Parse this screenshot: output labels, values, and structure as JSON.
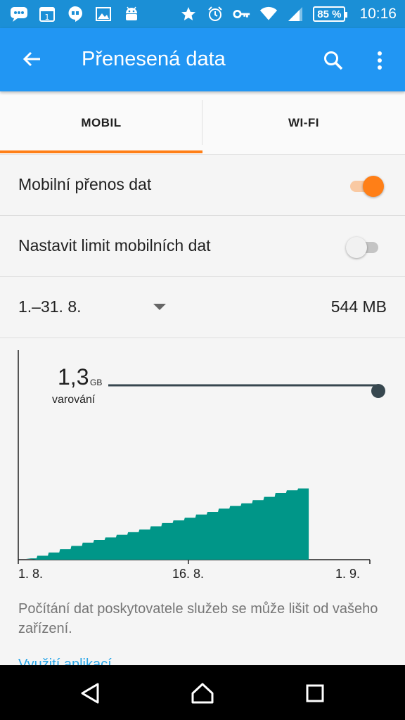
{
  "statusbar": {
    "battery": "85 %",
    "time": "10:16",
    "left_icons": [
      "chat-icon",
      "calendar-icon",
      "hangouts-icon",
      "gallery-icon",
      "android-icon"
    ],
    "right_icons": [
      "star-icon",
      "alarm-icon",
      "key-icon",
      "wifi-icon",
      "signal-icon"
    ],
    "calendar_day": "1"
  },
  "appbar": {
    "title": "Přenesená data"
  },
  "tabs": {
    "mobil": "MOBIL",
    "wifi": "WI-FI",
    "active": "mobil"
  },
  "settings": {
    "mobile_data_label": "Mobilní přenos dat",
    "mobile_data_on": true,
    "limit_label": "Nastavit limit mobilních dat",
    "limit_on": false
  },
  "period": {
    "range": "1.–31. 8.",
    "total": "544 MB"
  },
  "chart_data": {
    "type": "area",
    "warning_value": "1,3",
    "warning_unit": "GB",
    "warning_label": "varování",
    "x_tick_labels": [
      "1. 8.",
      "16. 8.",
      "1. 9."
    ],
    "x_days": [
      1,
      2,
      3,
      4,
      5,
      6,
      7,
      8,
      9,
      10,
      11,
      12,
      13,
      14,
      15,
      16,
      17,
      18,
      19,
      20,
      21,
      22,
      23,
      24,
      25
    ],
    "cumulative_mb": [
      10,
      30,
      55,
      80,
      105,
      130,
      150,
      170,
      190,
      210,
      230,
      255,
      280,
      300,
      320,
      345,
      365,
      390,
      410,
      430,
      455,
      480,
      510,
      530,
      544
    ],
    "y_max_mb": 1331,
    "x_range_days": [
      1,
      32
    ],
    "colors": {
      "fill": "#009688",
      "warning_line": "#37474f"
    }
  },
  "note": "Počítání dat poskytovatele služeb se může lišit od vašeho zařízení.",
  "link": "Využití aplikací",
  "colors": {
    "statusbar": "#1b8fd6",
    "appbar": "#2196f3",
    "accent": "#ff7f17"
  }
}
